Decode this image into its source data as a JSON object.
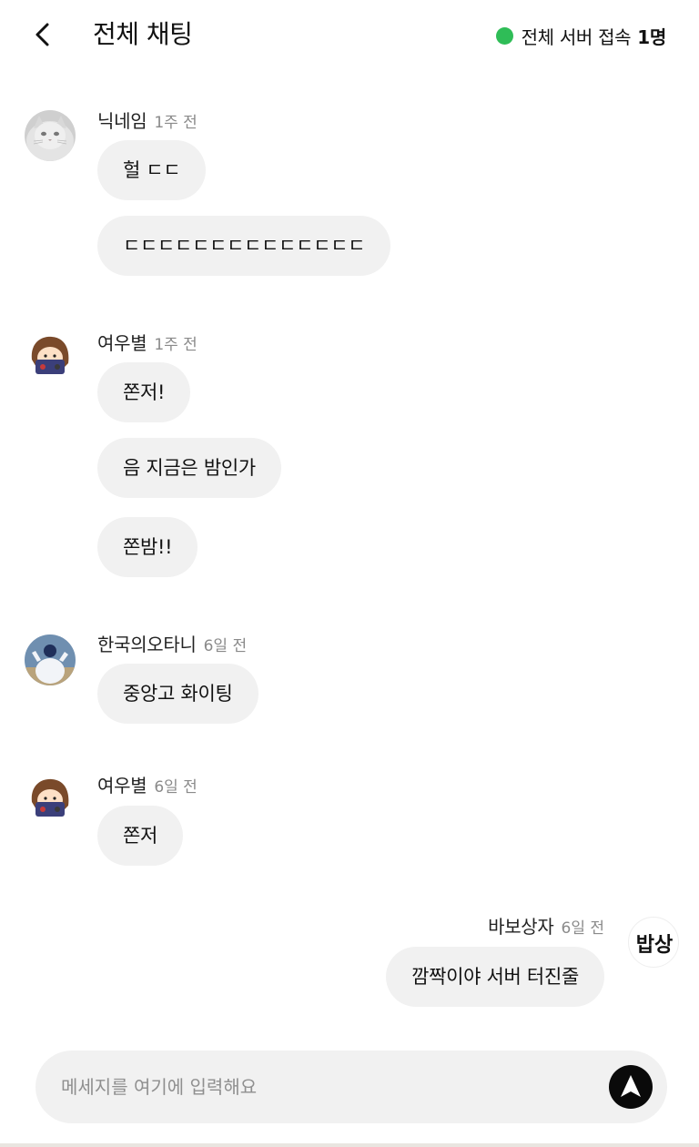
{
  "header": {
    "title": "전체 채팅",
    "online_label": "전체 서버 접속",
    "online_count": "1명",
    "online_color": "#2fbd57"
  },
  "messages": [
    {
      "name": "닉네임",
      "time": "1주 전",
      "avatar": "cat-avatar",
      "bubbles": [
        "헐 ㄷㄷ",
        "ㄷㄷㄷㄷㄷㄷㄷㄷㄷㄷㄷㄷㄷㄷ"
      ]
    },
    {
      "name": "여우별",
      "time": "1주 전",
      "avatar": "girl-character-avatar",
      "bubbles": [
        "쫀저!",
        "음 지금은 밤인가",
        "쫀밤!!"
      ]
    },
    {
      "name": "한국의오타니",
      "time": "6일 전",
      "avatar": "baseball-player-avatar",
      "bubbles": [
        "중앙고 화이팅"
      ]
    },
    {
      "name": "여우별",
      "time": "6일 전",
      "avatar": "girl-character-avatar",
      "bubbles": [
        "쫀저"
      ]
    },
    {
      "name": "바보상자",
      "time": "6일 전",
      "avatar": "babsang-logo-avatar",
      "avatar_text": "밥상",
      "bubbles": [
        "깜짝이야 서버 터진줄"
      ]
    }
  ],
  "composer": {
    "placeholder": "메세지를 여기에 입력해요",
    "value": ""
  }
}
